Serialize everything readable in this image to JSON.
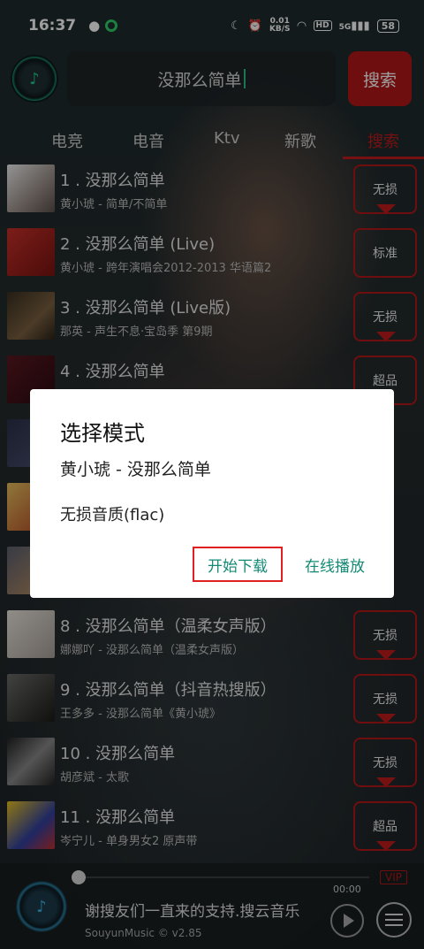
{
  "status_bar": {
    "time": "16:37",
    "net_speed_value": "0.01",
    "net_speed_unit": "KB/S",
    "hd": "HD",
    "signal": "5G",
    "battery": "58"
  },
  "search": {
    "query": "没那么简单",
    "button_label": "搜索"
  },
  "tabs": [
    {
      "label": "电竞"
    },
    {
      "label": "电音"
    },
    {
      "label": "Ktv"
    },
    {
      "label": "新歌"
    },
    {
      "label": "搜索",
      "active": true
    }
  ],
  "songs": [
    {
      "title": "1 . 没那么简单",
      "subtitle": "黄小琥 - 简单/不简单",
      "quality": "无损"
    },
    {
      "title": "2 . 没那么简单 (Live)",
      "subtitle": "黄小琥 - 跨年演唱会2012-2013 华语篇2",
      "quality": "标准"
    },
    {
      "title": "3 . 没那么简单 (Live版)",
      "subtitle": "那英 - 声生不息·宝岛季 第9期",
      "quality": "无损"
    },
    {
      "title": "4 . 没那么简单",
      "subtitle": "",
      "quality": "超品"
    },
    {
      "title": "",
      "subtitle": "",
      "quality": ""
    },
    {
      "title": "",
      "subtitle": "",
      "quality": ""
    },
    {
      "title": "",
      "subtitle": "",
      "quality": ""
    },
    {
      "title": "8 . 没那么简单（温柔女声版）",
      "subtitle": "娜娜吖 - 没那么简单（温柔女声版）",
      "quality": "无损"
    },
    {
      "title": "9 . 没那么简单（抖音热搜版）",
      "subtitle": "王多多 - 没那么简单《黄小琥》",
      "quality": "无损"
    },
    {
      "title": "10 . 没那么简单",
      "subtitle": "胡彦斌 - 太歌",
      "quality": "无损"
    },
    {
      "title": "11 . 没那么简单",
      "subtitle": "岑宁儿 - 单身男女2 原声带",
      "quality": "超品"
    }
  ],
  "dialog": {
    "title": "选择模式",
    "song": "黄小琥 - 没那么简单",
    "quality": "无损音质(flac)",
    "download_label": "开始下载",
    "play_online_label": "在线播放"
  },
  "player": {
    "time": "00:00",
    "vip": "VIP",
    "marquee": "谢搜友们一直来的支持.搜云音乐",
    "version": "SouyunMusic © v2.85"
  },
  "colors": {
    "accent_red": "#b31818",
    "dialog_button_text": "#148a74"
  }
}
